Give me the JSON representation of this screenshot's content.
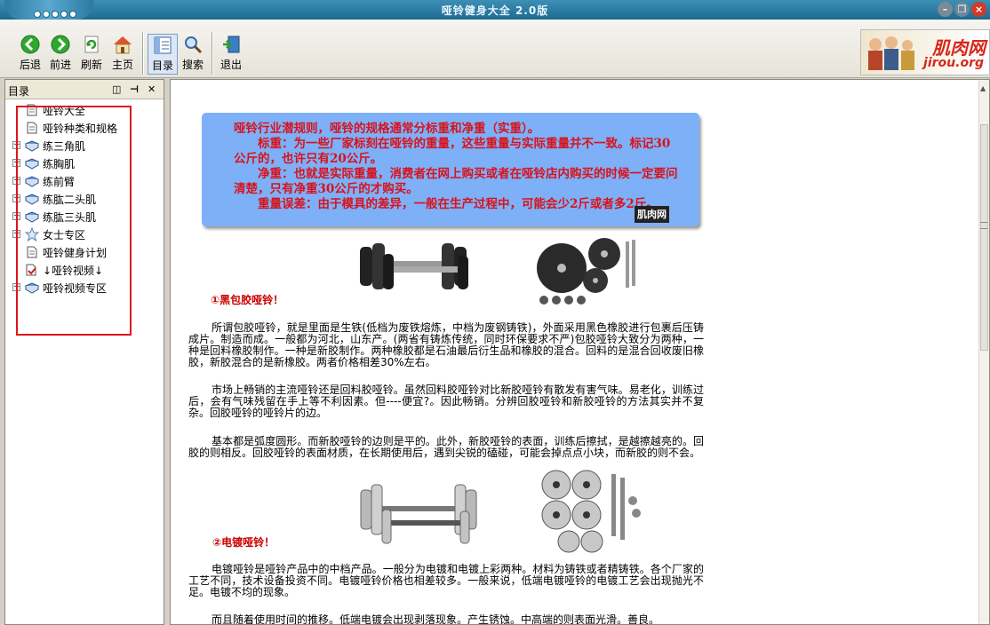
{
  "window": {
    "title": "哑铃健身大全   2.0版"
  },
  "toolbar": {
    "back": "后退",
    "forward": "前进",
    "refresh": "刷新",
    "home": "主页",
    "toc": "目录",
    "search": "搜索",
    "exit": "退出"
  },
  "logo": {
    "line1": "肌肉网",
    "line2": "jirou.org"
  },
  "sidebar": {
    "title": "目录",
    "items": [
      {
        "label": "哑铃大全",
        "icon": "page-icon",
        "expandable": false
      },
      {
        "label": "哑铃种类和规格",
        "icon": "page-icon",
        "expandable": false
      },
      {
        "label": "练三角肌",
        "icon": "book-icon",
        "expandable": true
      },
      {
        "label": "练胸肌",
        "icon": "book-icon",
        "expandable": true
      },
      {
        "label": "练前臂",
        "icon": "book-icon",
        "expandable": true
      },
      {
        "label": "练肱二头肌",
        "icon": "book-icon",
        "expandable": true
      },
      {
        "label": "练肱三头肌",
        "icon": "book-icon",
        "expandable": true
      },
      {
        "label": "女士专区",
        "icon": "star-icon",
        "expandable": true
      },
      {
        "label": "哑铃健身计划",
        "icon": "page-icon",
        "expandable": false
      },
      {
        "label": "↓哑铃视频↓",
        "icon": "video-page-icon",
        "expandable": false
      },
      {
        "label": "哑铃视频专区",
        "icon": "book-icon",
        "expandable": true
      }
    ]
  },
  "article": {
    "note": [
      "哑铃行业潜规则，哑铃的规格通常分标重和净重（实重）。",
      "　　标重：为一些厂家标刻在哑铃的重量，这些重量与实际重量并不一致。标记30公斤的，也许只有20公斤。",
      "　　净重：也就是实际重量，消费者在网上购买或者在哑铃店内购买的时候一定要问清楚，只有净重30公斤的才购买。",
      "　　重量误差：由于模具的差异，一般在生产过程中，可能会少2斤或者多2斤。"
    ],
    "note_stamp": "肌肉网",
    "section1_title": "①黑包胶哑铃！",
    "para1": "所谓包胶哑铃，就是里面是生铁(低档为废铁熔炼，中档为废钢铸铁)，外面采用黑色橡胶进行包裹后压铸成片。制造而成。一般都为河北，山东产。(两省有铸炼传统，同时环保要求不严)包胶哑铃大致分为两种，一种是回料橡胶制作。一种是新胶制作。两种橡胶都是石油最后衍生品和橡胶的混合。回料的是混合回收废旧橡胶，新胶混合的是新橡胶。两者价格相差30%左右。",
    "para2": "市场上畅销的主流哑铃还是回料胶哑铃。虽然回料胶哑铃对比新胶哑铃有散发有害气味。易老化，训练过后，会有气味残留在手上等不利因素。但----便宜?。因此畅销。分辨回胶哑铃和新胶哑铃的方法其实并不复杂。回胶哑铃的哑铃片的边。",
    "para3": "基本都是弧度圆形。而新胶哑铃的边则是平的。此外，新胶哑铃的表面，训练后擦拭，是越擦越亮的。回胶的则相反。回胶哑铃的表面材质，在长期使用后，遇到尖锐的磕碰，可能会掉点点小块，而新胶的则不会。",
    "section2_title": "②电镀哑铃！",
    "para4": "电镀哑铃是哑铃产品中的中档产品。一般分为电镀和电镀上彩两种。材料为铸铁或者精铸铁。各个厂家的工艺不同，技术设备投资不同。电镀哑铃价格也相差较多。一般来说，低端电镀哑铃的电镀工艺会出现抛光不足。电镀不均的现象。",
    "para5": "而且随着使用时间的推移。低端电镀会出现剥落现象。产生锈蚀。中高端的则表面光滑。善良。"
  },
  "colors": {
    "title_bar": "#1e6a8f",
    "note_bg": "#7eb0f7",
    "note_text": "#d8121c",
    "section_title": "#cc0000",
    "highlight_box": "#e0141c"
  }
}
